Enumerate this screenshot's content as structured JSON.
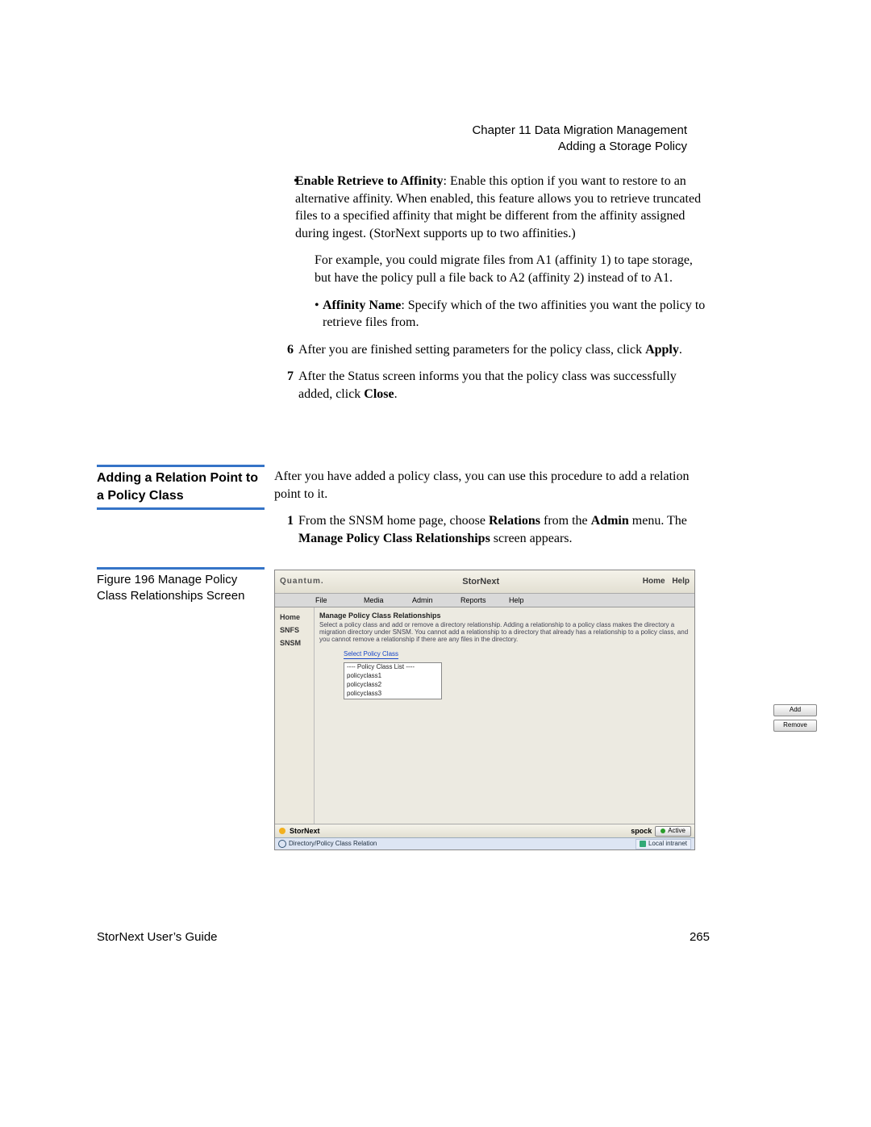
{
  "header": {
    "chapter": "Chapter 11  Data Migration Management",
    "section": "Adding a Storage Policy"
  },
  "body": {
    "bullet1_bold": "Enable Retrieve to Affinity",
    "bullet1_text": ": Enable this option if you want to restore to an alternative affinity. When enabled, this feature allows you to retrieve truncated files to a specified affinity that might be different from the affinity assigned during ingest. (StorNext supports up to two affinities.)",
    "bullet1_para2": "For example, you could migrate files from A1 (affinity 1) to tape storage, but have the policy pull a file back to A2 (affinity 2) instead of to A1.",
    "subbullet_bold": "Affinity Name",
    "subbullet_text": ": Specify which of the two affinities you want the policy to retrieve files from.",
    "step6_num": "6",
    "step6a": "After you are finished setting parameters for the policy class, click ",
    "step6b": "Apply",
    "step6c": ".",
    "step7_num": "7",
    "step7a": "After the Status screen informs you that the policy class was successfully added, click ",
    "step7b": "Close",
    "step7c": "."
  },
  "sidebar_heading": "Adding a Relation Point to a Policy Class",
  "section2": {
    "intro": "After you have added a policy class, you can use this procedure to add a relation point to it.",
    "step1_num": "1",
    "step1a": "From the SNSM home page, choose ",
    "step1b": "Relations",
    "step1c": " from the ",
    "step1d": "Admin",
    "step1e": " menu. The ",
    "step1f": "Manage Policy Class Relationships",
    "step1g": " screen appears."
  },
  "figure_caption": "Figure 196  Manage Policy Class Relationships Screen",
  "app": {
    "brand": "Quantum.",
    "title": "StorNext",
    "link_home": "Home",
    "link_help": "Help",
    "menu": {
      "file": "File",
      "media": "Media",
      "admin": "Admin",
      "reports": "Reports",
      "help": "Help"
    },
    "side": {
      "home": "Home",
      "snfs": "SNFS",
      "snsm": "SNSM"
    },
    "panel_title": "Manage Policy Class Relationships",
    "panel_desc": "Select a policy class and add or remove a directory relationship. Adding a relationship to a policy class makes the directory a migration directory under SNSM. You cannot add a relationship to a directory that already has a relationship to a policy class, and you cannot remove a relationship if there are any files in the directory.",
    "select_title": "Select Policy Class",
    "list_header": "---- Policy Class List ----",
    "items": [
      "policyclass1",
      "policyclass2",
      "policyclass3"
    ],
    "btn_add": "Add",
    "btn_remove": "Remove",
    "footer_brand": "StorNext",
    "footer_host": "spock",
    "footer_active": "Active",
    "status_path": "Directory/Policy Class Relation",
    "status_zone": "Local intranet"
  },
  "footer": {
    "left": "StorNext User’s Guide",
    "right": "265"
  }
}
